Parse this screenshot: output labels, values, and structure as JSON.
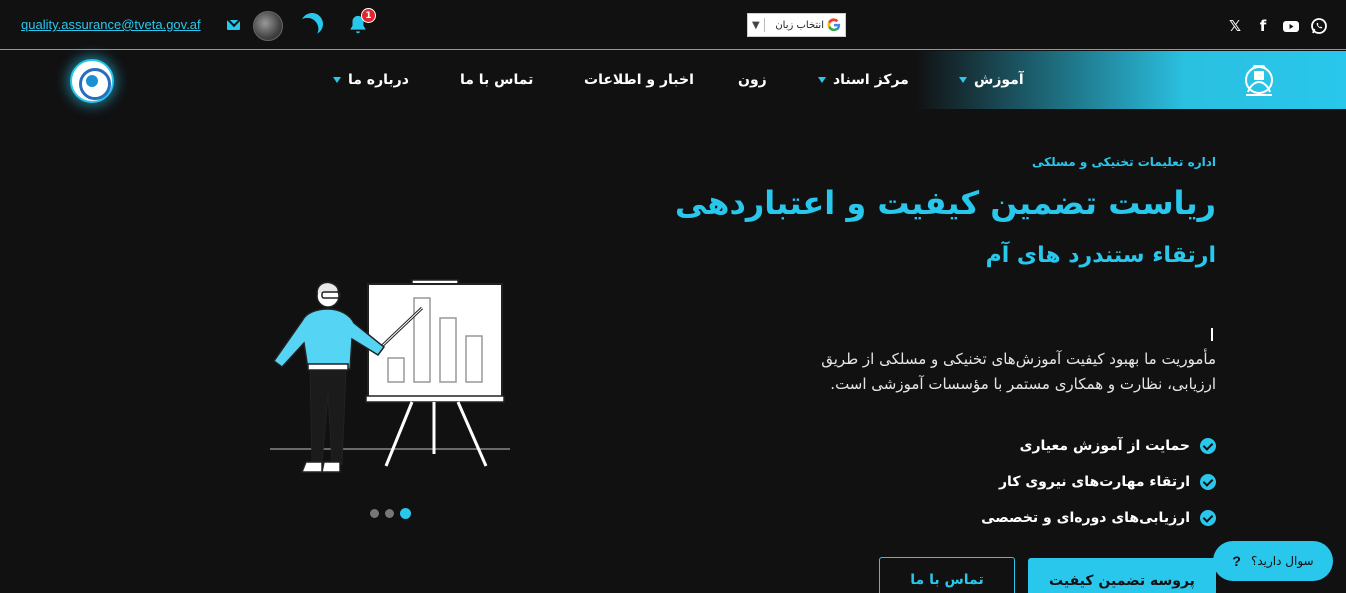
{
  "topbar": {
    "email": "quality.assurance@tveta.gov.af",
    "notification_count": "1",
    "language_selector": {
      "label": "انتخاب زبان",
      "arrow": "▼"
    },
    "socials": [
      "whatsapp-icon",
      "youtube-icon",
      "facebook-icon",
      "x-icon"
    ]
  },
  "nav": {
    "items": [
      {
        "label": "آموزش",
        "dropdown": true
      },
      {
        "label": "مرکز اسناد",
        "dropdown": true
      },
      {
        "label": "زون",
        "dropdown": false
      },
      {
        "label": "اخبار و اطلاعات",
        "dropdown": false
      },
      {
        "label": "تماس با ما",
        "dropdown": false
      },
      {
        "label": "درباره ما",
        "dropdown": true
      }
    ]
  },
  "hero": {
    "org": "اداره تعلیمات تخنیکی و مسلکی",
    "title": "ریاست تضمین کیفیت و اعتباردهی",
    "subtitle": "ارتقاء ستندرد های آم",
    "mission": "مأموریت ما بهبود کیفیت آموزش‌های تخنیکی و مسلکی از طریق ارزیابی، نظارت و همکاری مستمر با مؤسسات آموزشی است.",
    "features": [
      "حمایت از آموزش معیاری",
      "ارتقاء مهارت‌های نیروی کار",
      "ارزیابی‌های دوره‌ای و تخصصی"
    ],
    "primary_button": "پروسه تضمین کیفیت",
    "secondary_button": "تماس با ما",
    "slider": {
      "count": 3,
      "active": 1
    }
  },
  "help_widget": {
    "label": "سوال دارید؟",
    "icon": "?"
  },
  "colors": {
    "accent": "#29c7ec",
    "background": "#111112",
    "badge": "#e0262c"
  }
}
